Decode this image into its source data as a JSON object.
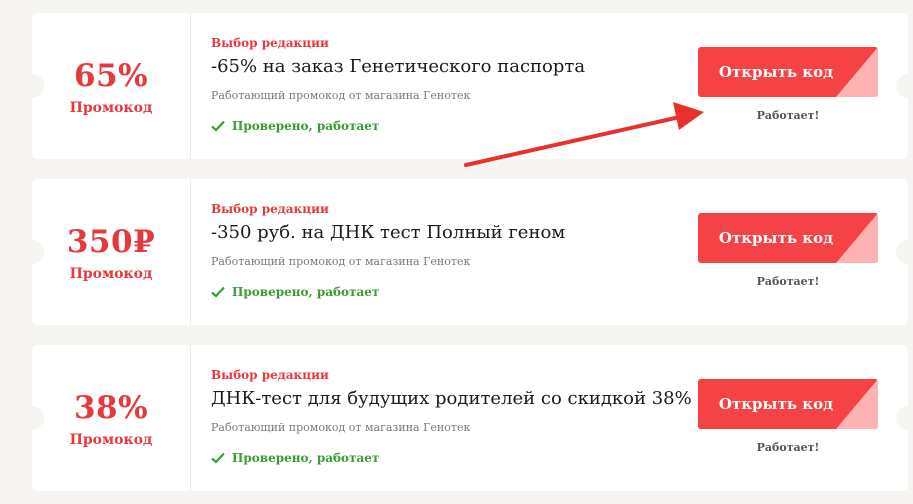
{
  "coupons": [
    {
      "value": "65%",
      "value_label": "Промокод",
      "tag": "Выбор редакции",
      "title": "-65% на заказ Генетического паспорта",
      "description": "Работающий промокод от магазина Генотек",
      "verified": "Проверено, работает",
      "button_label": "Открыть код",
      "status": "Работает!"
    },
    {
      "value": "350₽",
      "value_label": "Промокод",
      "tag": "Выбор редакции",
      "title": "-350 руб. на ДНК тест Полный геном",
      "description": "Работающий промокод от магазина Генотек",
      "verified": "Проверено, работает",
      "button_label": "Открыть код",
      "status": "Работает!"
    },
    {
      "value": "38%",
      "value_label": "Промокод",
      "tag": "Выбор редакции",
      "title": "ДНК-тест для будущих родителей со скидкой 38%",
      "description": "Работающий промокод от магазина Генотек",
      "verified": "Проверено, работает",
      "button_label": "Открыть код",
      "status": "Работает!"
    }
  ],
  "colors": {
    "accent": "#e5393b",
    "button": "#f44245",
    "button_corner": "#ffb2b2",
    "verified": "#3a9b35",
    "background": "#f6f5f1",
    "arrow": "#e8302c"
  },
  "icons": {
    "verified": "check-icon",
    "annotation": "red-arrow-icon"
  }
}
